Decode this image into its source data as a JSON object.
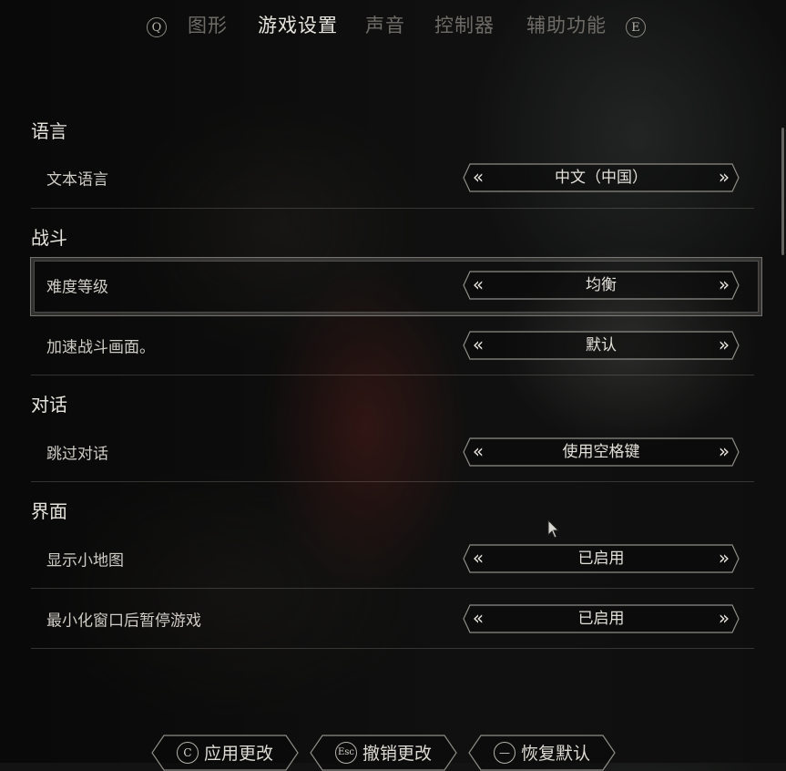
{
  "tabs": {
    "prev_key": "Q",
    "next_key": "E",
    "items": [
      {
        "label": "图形",
        "active": false
      },
      {
        "label": "游戏设置",
        "active": true
      },
      {
        "label": "声音",
        "active": false
      },
      {
        "label": "控制器",
        "active": false
      },
      {
        "label": "辅助功能",
        "active": false
      }
    ]
  },
  "sections": {
    "language": {
      "title": "语言",
      "rows": [
        {
          "label": "文本语言",
          "value": "中文（中国）"
        }
      ]
    },
    "combat": {
      "title": "战斗",
      "rows": [
        {
          "label": "难度等级",
          "value": "均衡"
        },
        {
          "label": "加速战斗画面。",
          "value": "默认"
        }
      ]
    },
    "dialogue": {
      "title": "对话",
      "rows": [
        {
          "label": "跳过对话",
          "value": "使用空格键"
        }
      ]
    },
    "interface": {
      "title": "界面",
      "rows": [
        {
          "label": "显示小地图",
          "value": "已启用"
        },
        {
          "label": "最小化窗口后暂停游戏",
          "value": "已启用"
        }
      ]
    }
  },
  "selector_arrows": {
    "left": "«",
    "right": "»"
  },
  "bottom": {
    "apply": {
      "key": "C",
      "label": "应用更改"
    },
    "revert": {
      "key": "Esc",
      "label": "撤销更改"
    },
    "reset": {
      "key": "—",
      "label": "恢复默认"
    }
  },
  "colors": {
    "accent": "#e8e5de",
    "muted_tab": "#6f6c67",
    "background": "#121312"
  }
}
